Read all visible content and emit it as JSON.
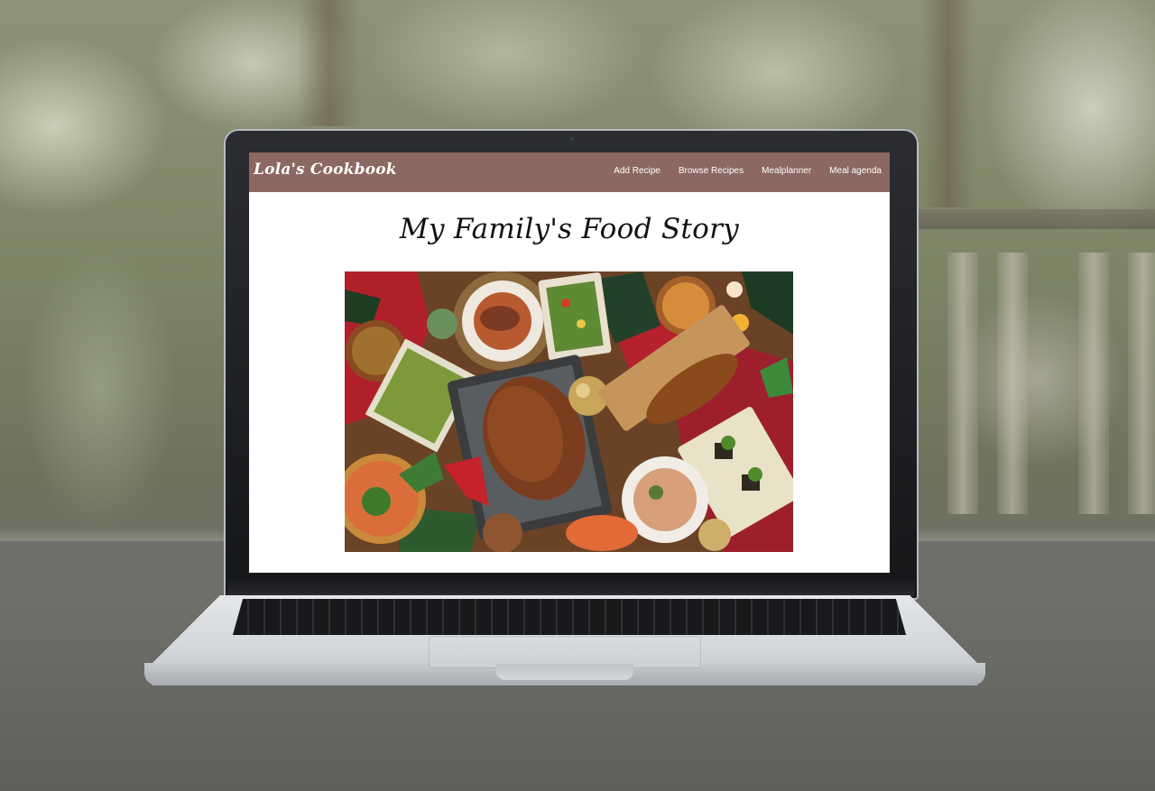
{
  "site": {
    "brand": "Lola's Cookbook",
    "nav": [
      {
        "label": "Add Recipe"
      },
      {
        "label": "Browse Recipes"
      },
      {
        "label": "Mealplanner"
      },
      {
        "label": "Meal agenda"
      }
    ]
  },
  "main": {
    "title": "My Family's Food Story"
  },
  "colors": {
    "navbar": "#8b6861",
    "page_background": "#ffffff",
    "title_text": "#111111"
  },
  "icons": [
    "food-spread-image"
  ]
}
